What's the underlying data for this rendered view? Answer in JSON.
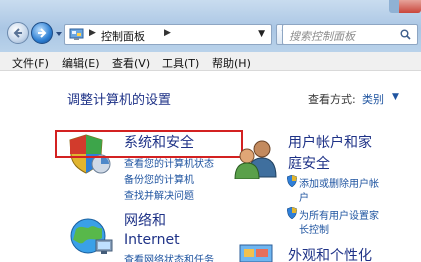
{
  "address_bar": {
    "breadcrumb": "控制面板",
    "search_placeholder": "搜索控制面板"
  },
  "menu": [
    {
      "label": "文件(F)"
    },
    {
      "label": "编辑(E)"
    },
    {
      "label": "查看(V)"
    },
    {
      "label": "工具(T)"
    },
    {
      "label": "帮助(H)"
    }
  ],
  "main": {
    "title": "调整计算机的设置",
    "view_by_label": "查看方式:",
    "view_by_value": "类别"
  },
  "categories": {
    "system_security": {
      "title": "系统和安全",
      "links": [
        "查看您的计算机状态",
        "备份您的计算机",
        "查找并解决问题"
      ]
    },
    "network": {
      "title_line1": "网络和",
      "title_line2": "Internet",
      "links": [
        "查看网络状态和任务"
      ]
    },
    "user_accounts": {
      "title_line1": "用户帐户和家",
      "title_line2": "庭安全",
      "links": [
        {
          "line1": "添加或删除用户帐",
          "line2": "户"
        },
        {
          "line1": "为所有用户设置家",
          "line2": "长控制"
        }
      ]
    },
    "appearance": {
      "title": "外观和个性化"
    }
  },
  "colors": {
    "heading_blue": "#1e3287",
    "link_blue": "#1f54a0",
    "highlight_red": "#d32121"
  },
  "icons": {
    "back": "back-arrow-icon",
    "forward": "forward-arrow-icon",
    "refresh": "refresh-icon",
    "search": "search-icon",
    "shield": "shield-icon",
    "users": "users-icon",
    "network": "network-globe-icon",
    "appearance": "appearance-icon"
  }
}
